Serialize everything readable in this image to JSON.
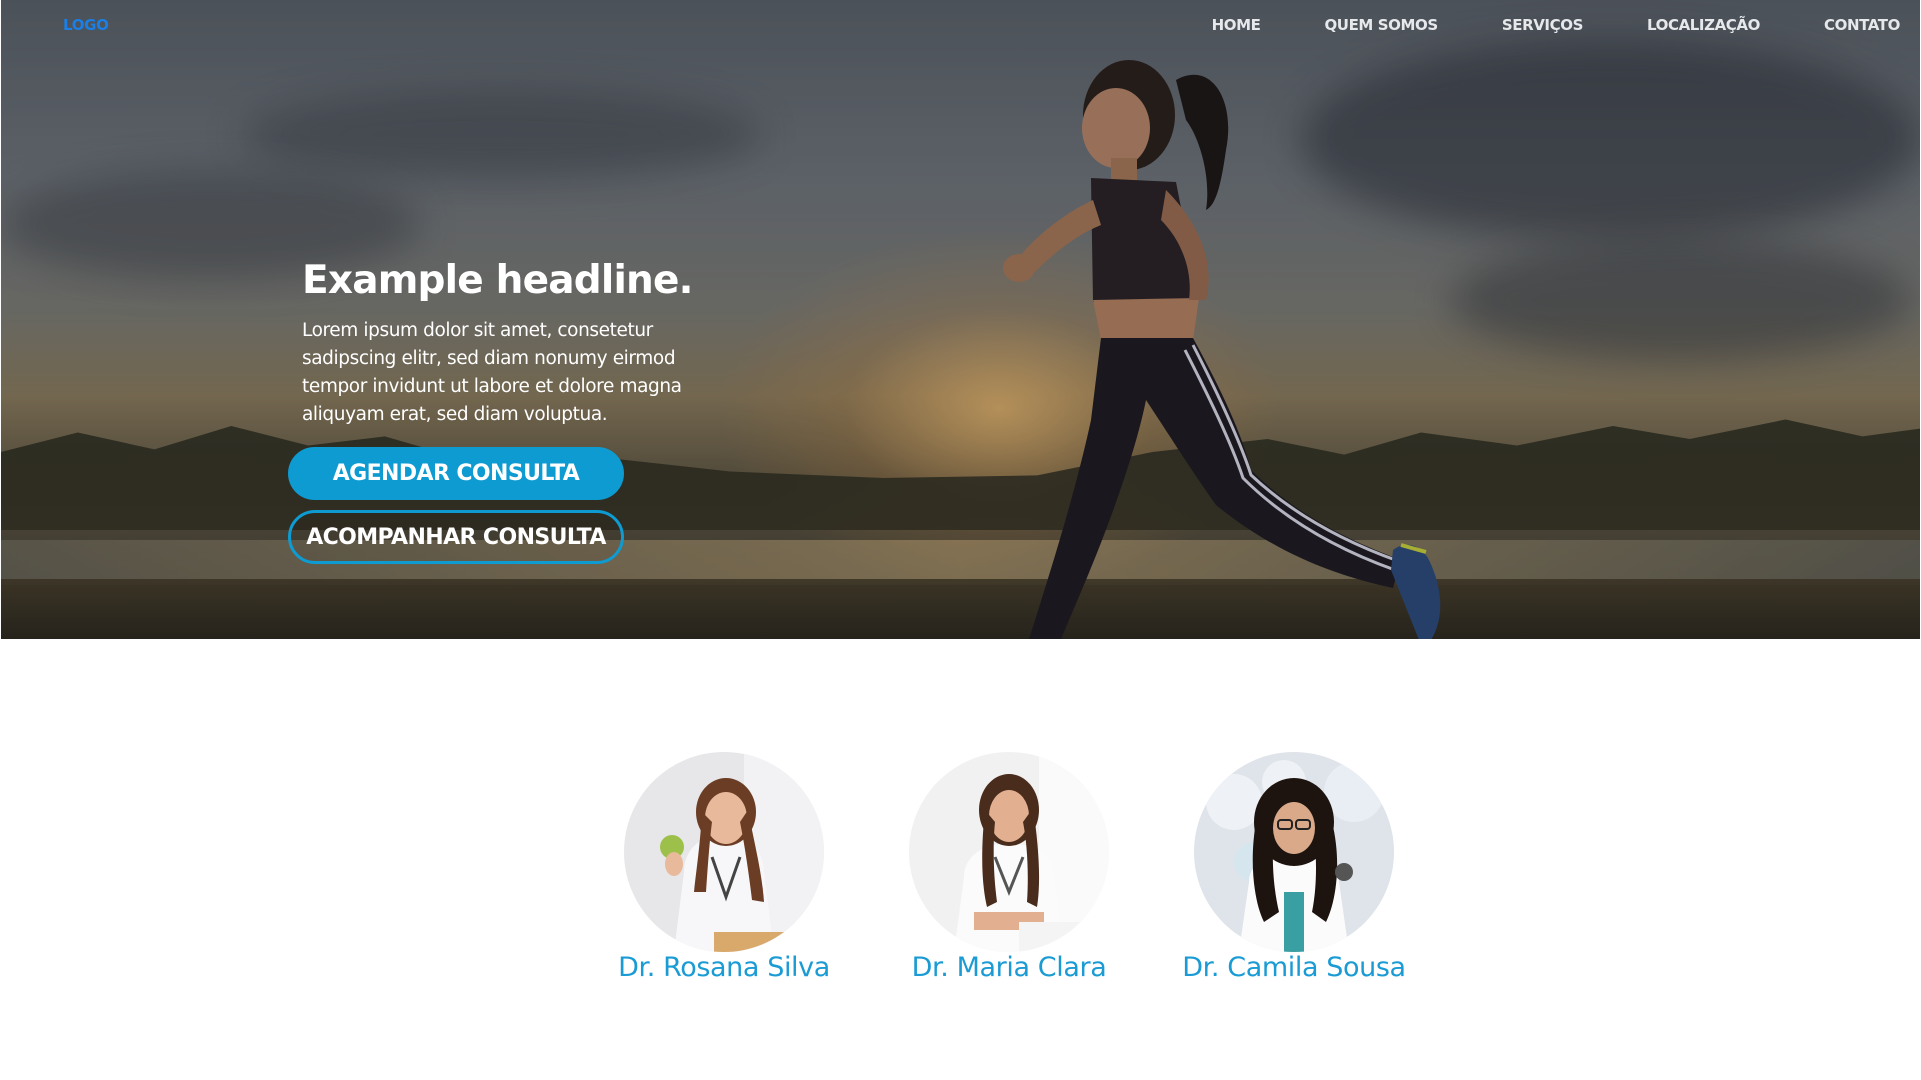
{
  "nav": {
    "logo": "LOGO",
    "items": [
      {
        "label": "HOME"
      },
      {
        "label": "QUEM SOMOS"
      },
      {
        "label": "SERVIÇOS"
      },
      {
        "label": "LOCALIZAÇÃO"
      },
      {
        "label": "CONTATO"
      }
    ]
  },
  "hero": {
    "headline": "Example headline.",
    "lead": "Lorem ipsum dolor sit amet, consetetur sadipscing elitr, sed diam nonumy eirmod tempor invidunt ut labore et dolore magna aliquyam erat, sed diam voluptua.",
    "primary_button": "AGENDAR CONSULTA",
    "secondary_button": "ACOMPANHAR CONSULTA"
  },
  "doctors": [
    {
      "name": "Dr. Rosana Silva"
    },
    {
      "name": "Dr. Maria Clara"
    },
    {
      "name": "Dr. Camila Sousa"
    }
  ],
  "colors": {
    "accent": "#0e9bd1",
    "logo": "#1a7fe6",
    "doctor_name": "#1a9bd4",
    "nav_text": "#e6e8ec"
  }
}
